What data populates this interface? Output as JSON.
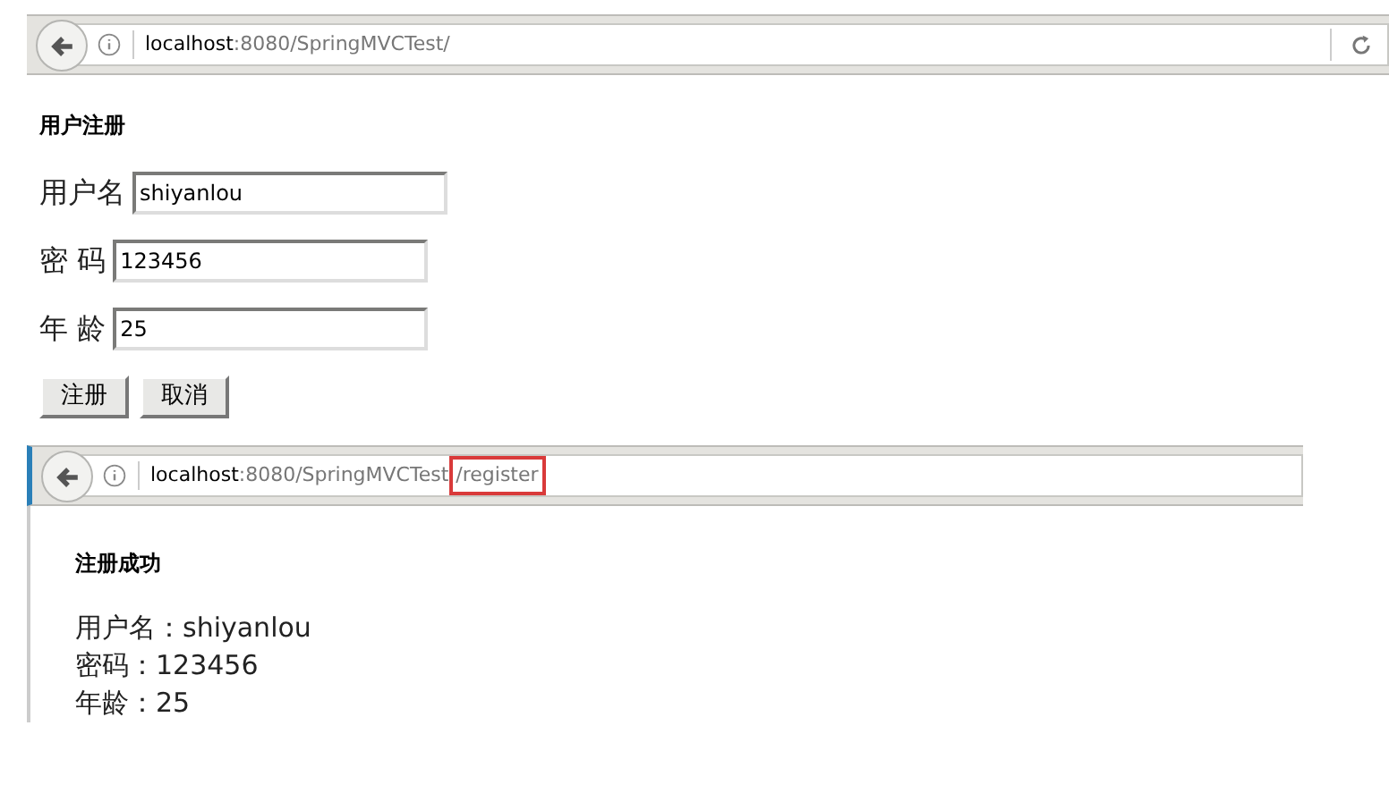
{
  "form_page": {
    "address_bar": {
      "host": "localhost",
      "path": ":8080/SpringMVCTest/"
    },
    "heading": "用户注册",
    "fields": [
      {
        "label": "用户名",
        "value": "shiyanlou"
      },
      {
        "label": "密 码",
        "value": "123456"
      },
      {
        "label": "年 龄",
        "value": "25"
      }
    ],
    "buttons": [
      "注册",
      "取消"
    ]
  },
  "result_page": {
    "address_bar": {
      "host": "localhost",
      "path": ":8080/SpringMVCTest",
      "highlighted_path": "/register"
    },
    "heading": "注册成功",
    "lines": [
      "用户名：shiyanlou",
      "密码：123456",
      "年龄：25"
    ]
  }
}
